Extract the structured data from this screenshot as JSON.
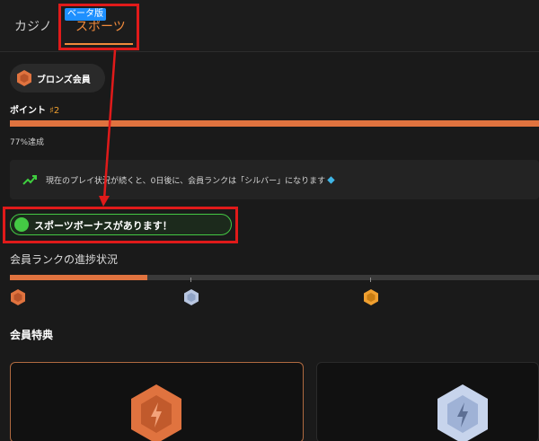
{
  "tabs": {
    "casino": "カジノ",
    "sports": "スポーツ",
    "beta": "ベータ版"
  },
  "member": {
    "level": "ブロンズ会員"
  },
  "points": {
    "label": "ポイント",
    "value": "♯2"
  },
  "progress": {
    "achieved_label": "77%達成",
    "percent": 77
  },
  "status": {
    "message": "現在のプレイ状況が続くと、0日後に、会員ランクは「シルバー」になります"
  },
  "bonus": {
    "label": "スポーツボーナスがあります！"
  },
  "rank_progress": {
    "title": "会員ランクの進捗状況",
    "fraction": 0.26
  },
  "perks": {
    "title": "会員特典"
  },
  "colors": {
    "accent": "#f08a3c",
    "bronze": "#e0733f",
    "silver": "#b8c6e0",
    "gold": "#f0a030",
    "bonus_green": "#44c844",
    "annotation_red": "#e01a1a"
  },
  "icons": [
    "bronze-gem-icon",
    "silver-gem-icon",
    "gold-gem-icon",
    "trend-up-icon",
    "bonus-icon",
    "diamond-icon"
  ]
}
